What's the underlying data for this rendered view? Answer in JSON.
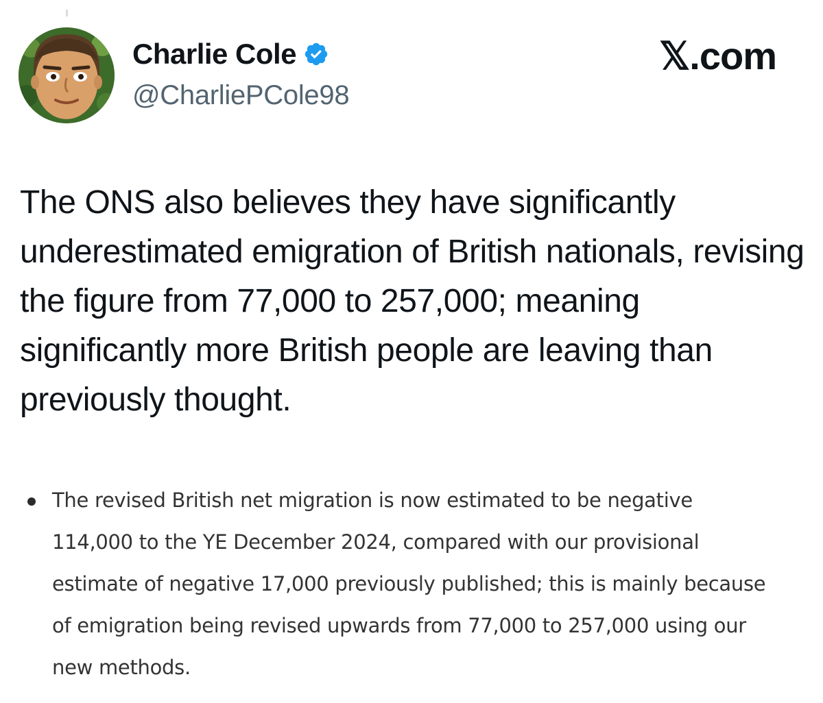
{
  "author": {
    "display_name": "Charlie Cole",
    "handle": "@CharliePCole98",
    "verified": true,
    "verified_color": "#1d9bf0"
  },
  "site_mark": "𝕏.com",
  "tweet": {
    "text": "The ONS also believes they have significantly underestimated emigration of British nationals, revising the figure from 77,000 to 257,000; meaning significantly more British people are leaving than previously thought."
  },
  "quoted_excerpt": {
    "bullet": "The revised British net migration is now estimated to be negative 114,000 to the YE December 2024, compared with our provisional estimate of negative 17,000 previously published; this is mainly because of emigration being revised upwards from 77,000 to 257,000 using our new methods."
  },
  "icons": {
    "verified": "verified-badge-icon",
    "avatar": "cartoon-face-avatar"
  }
}
